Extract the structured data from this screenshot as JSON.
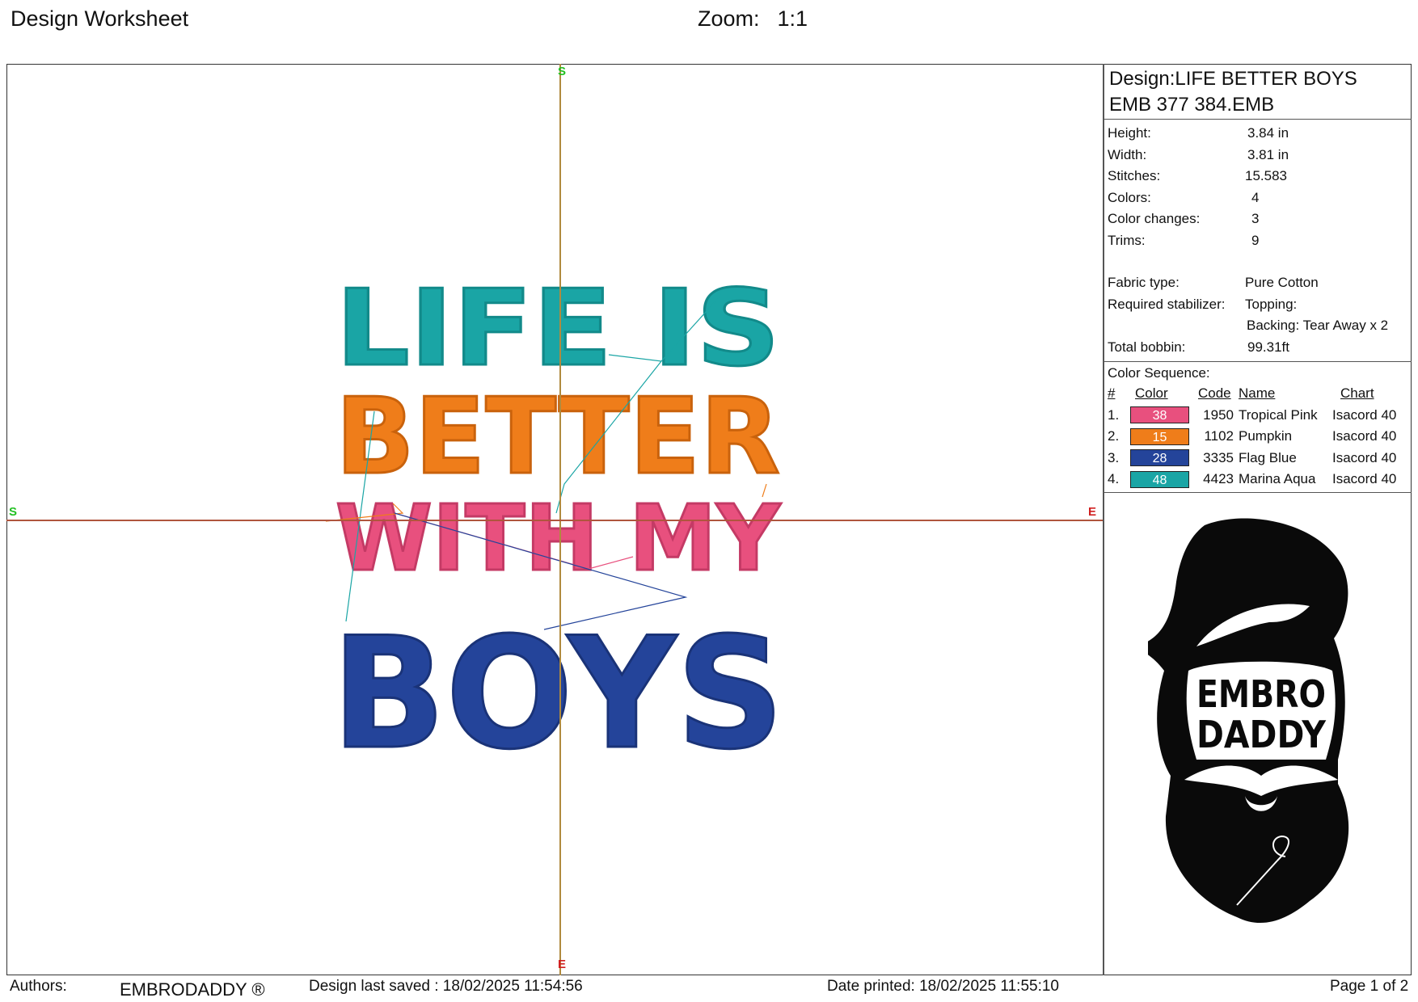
{
  "header": {
    "title": "Design Worksheet",
    "zoom_label": "Zoom:",
    "zoom_value": "1:1"
  },
  "canvas": {
    "start_marker": "S",
    "end_marker": "E",
    "design_text": {
      "line1": "LIFE IS",
      "line2": "BETTER",
      "line3": "WITH MY",
      "line4": "BOYS"
    }
  },
  "panel": {
    "design_name": "Design:LIFE BETTER BOYS",
    "file_name": "EMB 377 384.EMB",
    "properties": [
      {
        "label": "Height:",
        "value": "3.84 in"
      },
      {
        "label": "Width:",
        "value": "3.81 in"
      },
      {
        "label": "Stitches:",
        "value": "15.583"
      },
      {
        "label": "Colors:",
        "value": "4"
      },
      {
        "label": "Color changes:",
        "value": "3"
      },
      {
        "label": "Trims:",
        "value": "9"
      }
    ],
    "fabric_label": "Fabric type:",
    "fabric_value": "Pure Cotton",
    "stabilizer_label": "Required stabilizer:",
    "stabilizer_topping": "Topping:",
    "stabilizer_backing": "Backing: Tear Away x 2",
    "bobbin_label": "Total bobbin:",
    "bobbin_value": "99.31ft",
    "sequence_title": "Color Sequence:",
    "sequence_headers": {
      "num": "#",
      "color": "Color",
      "code": "Code",
      "name": "Name",
      "chart": "Chart"
    },
    "sequence": [
      {
        "num": "1.",
        "swatch": "38",
        "hex": "#e8507e",
        "code": "1950",
        "name": "Tropical Pink",
        "chart": "Isacord 40"
      },
      {
        "num": "2.",
        "swatch": "15",
        "hex": "#ef7d1a",
        "code": "1102",
        "name": "Pumpkin",
        "chart": "Isacord 40"
      },
      {
        "num": "3.",
        "swatch": "28",
        "hex": "#24449a",
        "code": "3335",
        "name": "Flag Blue",
        "chart": "Isacord 40"
      },
      {
        "num": "4.",
        "swatch": "48",
        "hex": "#1aa5a5",
        "code": "4423",
        "name": "Marina Aqua",
        "chart": "Isacord 40"
      }
    ],
    "logo_text_1": "EMBRO",
    "logo_text_2": "DADDY"
  },
  "footer": {
    "authors_label": "Authors:",
    "authors_value": "EMBRODADDY ®",
    "saved": "Design last saved : 18/02/2025 11:54:56",
    "printed": "Date printed: 18/02/2025 11:55:10",
    "page": "Page 1 of 2"
  }
}
